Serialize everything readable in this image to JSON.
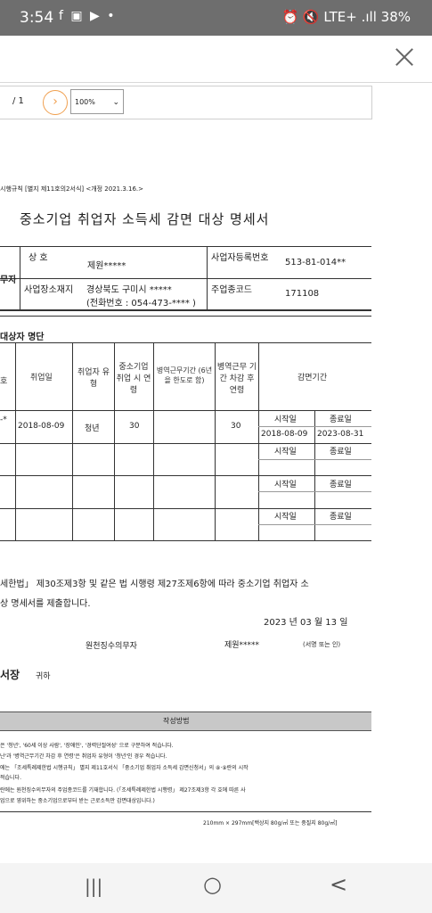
{
  "status_bar": {
    "time": "3:54",
    "app_icons": "f ▣ ▶ •",
    "right_icons": "⏰ 🔇 LTE+ .ıll 38%"
  },
  "viewer": {
    "page": "/ 1",
    "zoom": "100%"
  },
  "form": {
    "law_ref": "시행규칙 [별지 제11호의2서식] <개정 2021.3.16.>",
    "title": "중소기업 취업자 소득세 감면 대상 명세서",
    "row_label": "무자",
    "sanghо_label": "상 호",
    "sanghо_value": "제원*****",
    "bizno_label": "사업자등록번호",
    "bizno_value": "513-81-014**",
    "address_label": "사업장소재지",
    "address_value": "경상북도 구미시 *****",
    "phone": "(전화번호 : 054-473-**** )",
    "industry_label": "주업종코드",
    "industry_value": "171108",
    "section2": "대상자 명단",
    "headers": {
      "no": "호",
      "hire_date": "취업일",
      "type": "취업자 유형",
      "age": "중소기업 취업 시 연령",
      "military": "병역근무기간 (6년을 한도로 함)",
      "age_after": "병역근무 기간 차감 후 연령",
      "period": "감면기간"
    },
    "rows": [
      {
        "no": "-*",
        "hire_date": "2018-08-09",
        "type": "청년",
        "age": "30",
        "age_after": "30",
        "start_label": "시작일",
        "end_label": "종료일",
        "start": "2018-08-09",
        "end": "2023-08-31"
      },
      {
        "start_label": "시작일",
        "end_label": "종료일"
      },
      {
        "start_label": "시작일",
        "end_label": "종료일"
      },
      {
        "start_label": "시작일",
        "end_label": "종료일"
      }
    ],
    "statement_1": "세한법」 제30조제3항 및 같은 법 시행령 제27조제6항에 따라 중소기업 취업자 소",
    "statement_2": "상 명세서를 제출합니다.",
    "date": "2023 년 03 월 13 일",
    "withholder_label": "원천징수의무자",
    "withholder_value": "제원*****",
    "sign_note": "(서명 또는 인)",
    "addressee": "서장",
    "addressee_suffix": "귀하",
    "guide_title": "작성방법",
    "guide": [
      "은 '청년', '60세 이상 사람', '장애인', '경력단절여성' 으로 구분하여 적습니다.",
      "난'과 '병역근무기간 차감 후 연령'은 취업자 유형이 '청년'인 경우 적습니다.",
      "에는 「조세특례제한법 시행규칙」 별지 제11호서식 「중소기업 취업자 소득세 감면신청서」의 ⑧·⑨란의 시작",
      "적습니다.",
      "란에는 원천징수의무자의 주업종코드를 기재합니다. (「조세특례제한법 시행령」 제27조제3항 각 호에 따른 사",
      "업으로 영위하는 중소기업으로부터 받는 근로소득만 감면대상입니다.)"
    ],
    "paper": "210mm × 297mm[백상지 80g/㎡ 또는 중질지 80g/㎡]"
  },
  "nav": {
    "recents": "|||",
    "home": "○",
    "back": "<"
  }
}
